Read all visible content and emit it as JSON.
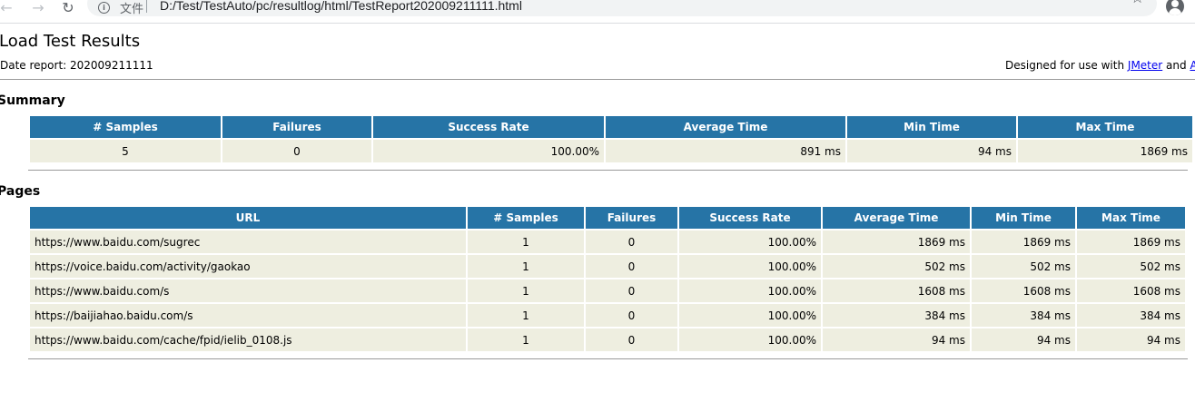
{
  "browser": {
    "security_label": "文件",
    "url": "D:/Test/TestAuto/pc/resultlog/html/TestReport202009211111.html"
  },
  "report": {
    "title": "Load Test Results",
    "date_report": "Date report: 202009211111",
    "designed_prefix": "Designed for use with",
    "designed_link1": "JMeter",
    "designed_and": "and",
    "designed_link2": "A"
  },
  "summary": {
    "title": "Summary",
    "headers": [
      "# Samples",
      "Failures",
      "Success Rate",
      "Average Time",
      "Min Time",
      "Max Time"
    ],
    "row": [
      "5",
      "0",
      "100.00%",
      "891 ms",
      "94 ms",
      "1869 ms"
    ]
  },
  "pages": {
    "title": "Pages",
    "headers": [
      "URL",
      "# Samples",
      "Failures",
      "Success Rate",
      "Average Time",
      "Min Time",
      "Max Time"
    ],
    "rows": [
      [
        "https://www.baidu.com/sugrec",
        "1",
        "0",
        "100.00%",
        "1869 ms",
        "1869 ms",
        "1869 ms"
      ],
      [
        "https://voice.baidu.com/activity/gaokao",
        "1",
        "0",
        "100.00%",
        "502 ms",
        "502 ms",
        "502 ms"
      ],
      [
        "https://www.baidu.com/s",
        "1",
        "0",
        "100.00%",
        "1608 ms",
        "1608 ms",
        "1608 ms"
      ],
      [
        "https://baijiahao.baidu.com/s",
        "1",
        "0",
        "100.00%",
        "384 ms",
        "384 ms",
        "384 ms"
      ],
      [
        "https://www.baidu.com/cache/fpid/ielib_0108.js",
        "1",
        "0",
        "100.00%",
        "94 ms",
        "94 ms",
        "94 ms"
      ]
    ]
  },
  "colors": {
    "header_bg": "#2674a6",
    "cell_bg": "#eeeee0",
    "link": "#0000ee"
  },
  "icons": [
    "back-arrow-icon",
    "forward-arrow-icon",
    "reload-icon",
    "info-icon",
    "star-icon",
    "account-icon"
  ]
}
